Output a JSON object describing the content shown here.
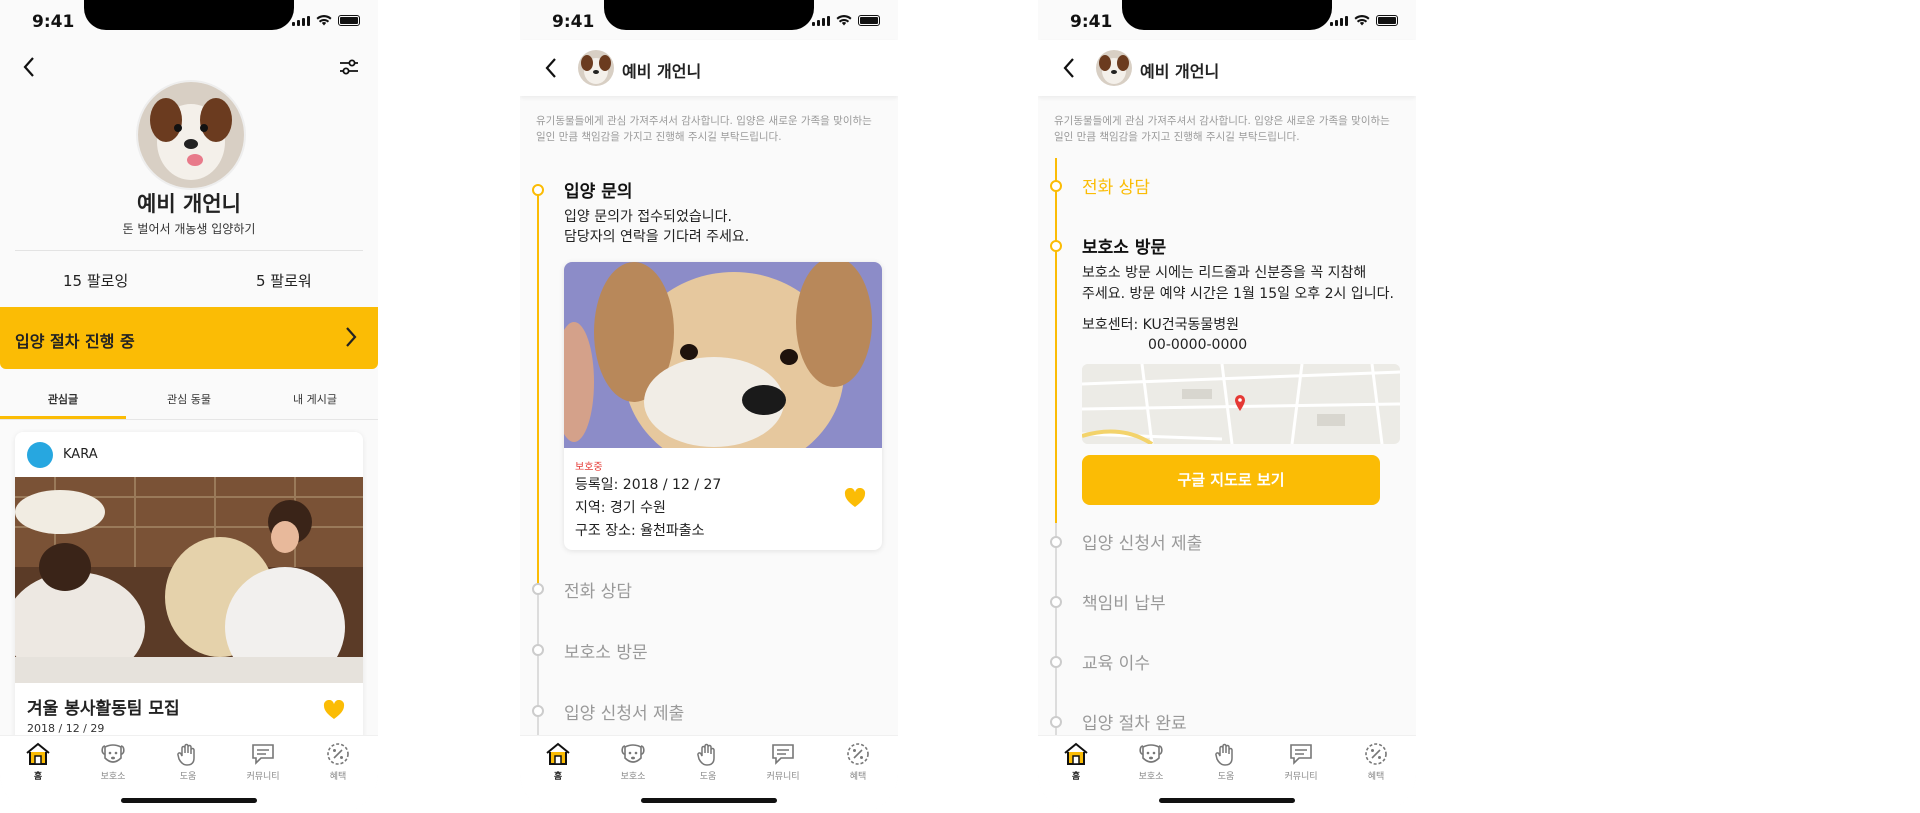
{
  "status": {
    "time": "9:41"
  },
  "nav": {
    "items": [
      "홈",
      "보호소",
      "도움",
      "커뮤니티",
      "혜택"
    ]
  },
  "profile": {
    "name": "예비 개언니",
    "bio": "돈 벌어서 개농생 입양하기",
    "following": "15 팔로잉",
    "followers": "5 팔로워",
    "banner": "입양 절차 진행 중",
    "tabs": [
      "관심글",
      "관심 동물",
      "내 게시글"
    ],
    "post": {
      "author": "KARA",
      "title": "겨울 봉사활동팀 모집",
      "date": "2018 / 12 / 29"
    }
  },
  "adoption": {
    "header_name": "예비 개언니",
    "notice": "유기동물들에게 관심 가져주셔서 감사합니다. 입양은 새로운 가족을 맞이하는 일인 만큼 책임감을 가지고 진행해 주시길 부탁드립니다.",
    "step_inquiry": "입양 문의",
    "inquiry_desc1": "입양 문의가 접수되었습니다.",
    "inquiry_desc2": "담당자의 연락을 기다려 주세요.",
    "dog": {
      "tag": "보호중",
      "registered": "등록일: 2018 / 12 / 27",
      "region": "지역: 경기 수원",
      "rescue": "구조 장소: 율천파출소"
    },
    "step_phone": "전화 상담",
    "step_visit": "보호소 방문",
    "step_apply": "입양 신청서 제출",
    "step_fee": "책임비 납부",
    "step_edu": "교육 이수",
    "step_done": "입양 절차 완료",
    "visit_desc1": "보호소 방문 시에는 리드줄과 신분증을 꼭 지참해",
    "visit_desc2": "주세요. 방문 예약 시간은 1월 15일 오후 2시 입니다.",
    "center": "보호센터: KU건국동물병원",
    "phone": "00-0000-0000",
    "map_button": "구글 지도로 보기"
  },
  "colors": {
    "accent": "#fbbc05",
    "alert": "#e53935"
  }
}
